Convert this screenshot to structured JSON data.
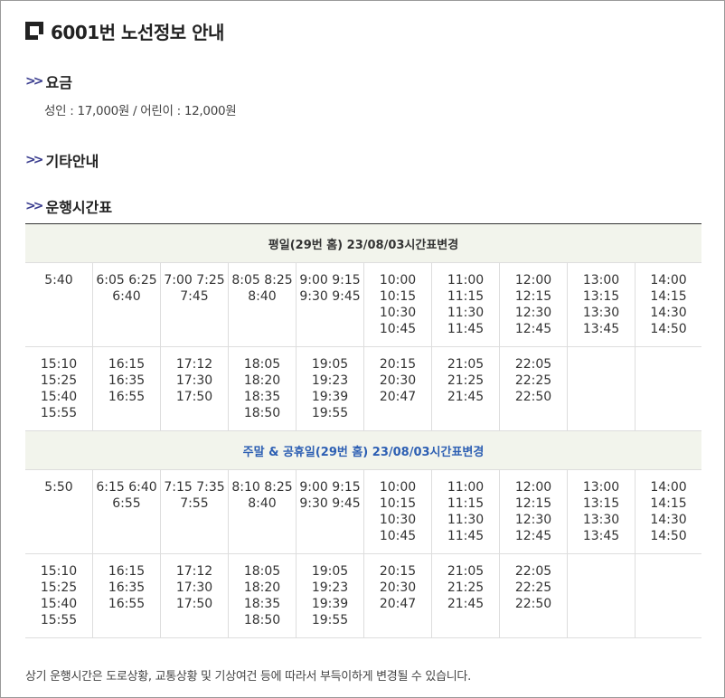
{
  "title": "6001번 노선정보 안내",
  "sections": {
    "fare": {
      "heading": "요금",
      "arrow": ">>",
      "text": "성인 : 17,000원 / 어린이 : 12,000원"
    },
    "other": {
      "heading": "기타안내",
      "arrow": ">>"
    },
    "timetable": {
      "heading": "운행시간표",
      "arrow": ">>"
    }
  },
  "weekday": {
    "header": "평일(29번 홈) 23/08/03시간표변경",
    "rows": [
      [
        [
          "5:40"
        ],
        [
          "6:05 6:25",
          "6:40"
        ],
        [
          "7:00 7:25",
          "7:45"
        ],
        [
          "8:05 8:25",
          "8:40"
        ],
        [
          "9:00 9:15",
          "9:30 9:45"
        ],
        [
          "10:00",
          "10:15",
          "10:30",
          "10:45"
        ],
        [
          "11:00",
          "11:15",
          "11:30",
          "11:45"
        ],
        [
          "12:00",
          "12:15",
          "12:30",
          "12:45"
        ],
        [
          "13:00",
          "13:15",
          "13:30",
          "13:45"
        ],
        [
          "14:00",
          "14:15",
          "14:30",
          "14:50"
        ]
      ],
      [
        [
          "15:10",
          "15:25",
          "15:40",
          "15:55"
        ],
        [
          "16:15",
          "16:35",
          "16:55"
        ],
        [
          "17:12",
          "17:30",
          "17:50"
        ],
        [
          "18:05",
          "18:20",
          "18:35",
          "18:50"
        ],
        [
          "19:05",
          "19:23",
          "19:39",
          "19:55"
        ],
        [
          "20:15",
          "20:30",
          "20:47"
        ],
        [
          "21:05",
          "21:25",
          "21:45"
        ],
        [
          "22:05",
          "22:25",
          "22:50"
        ],
        [],
        []
      ]
    ]
  },
  "weekend": {
    "header": "주말 & 공휴일(29번 홈) 23/08/03시간표변경",
    "rows": [
      [
        [
          "5:50"
        ],
        [
          "6:15 6:40",
          "6:55"
        ],
        [
          "7:15 7:35",
          "7:55"
        ],
        [
          "8:10 8:25",
          "8:40"
        ],
        [
          "9:00 9:15",
          "9:30 9:45"
        ],
        [
          "10:00",
          "10:15",
          "10:30",
          "10:45"
        ],
        [
          "11:00",
          "11:15",
          "11:30",
          "11:45"
        ],
        [
          "12:00",
          "12:15",
          "12:30",
          "12:45"
        ],
        [
          "13:00",
          "13:15",
          "13:30",
          "13:45"
        ],
        [
          "14:00",
          "14:15",
          "14:30",
          "14:50"
        ]
      ],
      [
        [
          "15:10",
          "15:25",
          "15:40",
          "15:55"
        ],
        [
          "16:15",
          "16:35",
          "16:55"
        ],
        [
          "17:12",
          "17:30",
          "17:50"
        ],
        [
          "18:05",
          "18:20",
          "18:35",
          "18:50"
        ],
        [
          "19:05",
          "19:23",
          "19:39",
          "19:55"
        ],
        [
          "20:15",
          "20:30",
          "20:47"
        ],
        [
          "21:05",
          "21:25",
          "21:45"
        ],
        [
          "22:05",
          "22:25",
          "22:50"
        ],
        [],
        []
      ]
    ]
  },
  "note": "상기 운행시간은 도로상황, 교통상황 및 기상여건 등에 따라서 부득이하게 변경될 수 있습니다.",
  "colors": {
    "accent_arrow": "#3a3d8f",
    "weekend_header": "#2d5fb3",
    "header_bg": "#f2f4ec"
  }
}
